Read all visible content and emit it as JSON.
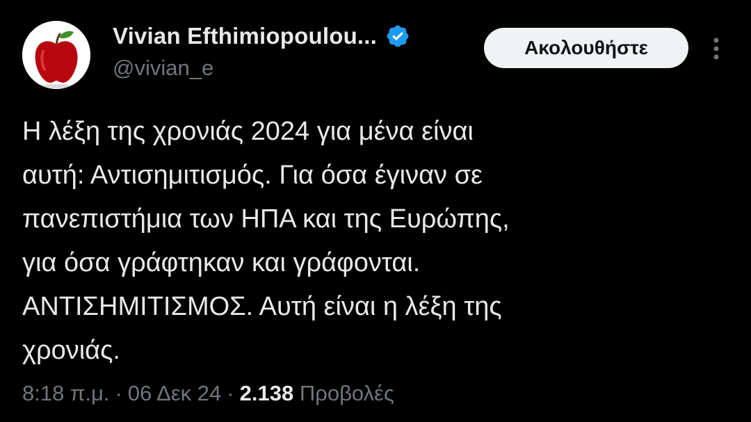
{
  "author": {
    "display_name": "Vivian Efthimiopoulou...",
    "handle": "@vivian_e",
    "verified": true,
    "avatar_icon": "red-apple-icon"
  },
  "follow_button": {
    "label": "Ακολουθήστε"
  },
  "tweet": {
    "lines": [
      "Η λέξη της χρονιάς 2024 για μένα είναι",
      "αυτή: Αντισημιτισμός. Για όσα έγιναν σε",
      "πανεπιστήμια των ΗΠΑ και της Ευρώπης,",
      "για όσα γράφτηκαν και γράφονται.",
      "ΑΝΤΙΣΗΜΙΤΙΣΜΟΣ. Αυτή είναι η λέξη της",
      "χρονιάς."
    ]
  },
  "meta": {
    "time": "8:18 π.μ.",
    "separator": "·",
    "date": "06 Δεκ 24",
    "views_count": "2.138",
    "views_label": "Προβολές"
  },
  "colors": {
    "background": "#000000",
    "text": "#e7e9ea",
    "secondary": "#71767b",
    "verified": "#1d9bf0",
    "button_bg": "#eff3f4"
  }
}
